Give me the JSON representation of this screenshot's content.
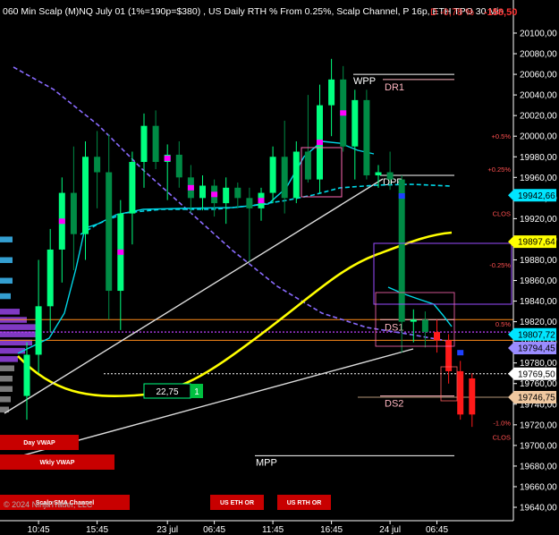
{
  "header": {
    "title": "060 Min Scalp (M)NQ July 01 (1%=190p=$380) , US Daily RTH % From 0.25%, Scalp Channel, P 16p, ETH TPO 30 Min",
    "overlay_text": "D -0,78 %",
    "overlay_value": "-158,50"
  },
  "footer": {
    "copyright": "© 2024 NinjaTrader, LLC"
  },
  "chart_data": {
    "type": "candlestick",
    "instrument": "(M)NQ July 01",
    "y_axis": {
      "ticks": [
        20100,
        20080,
        20060,
        20040,
        20020,
        20000,
        19980,
        19960,
        19940,
        19920,
        19900,
        19880,
        19860,
        19840,
        19820,
        19800,
        19780,
        19760,
        19740,
        19720,
        19700,
        19680,
        19660,
        19640
      ],
      "tick_labels": [
        "20100,00",
        "20080,00",
        "20060,00",
        "20040,00",
        "20020,00",
        "20000,00",
        "19980,00",
        "19960,00",
        "19940,00",
        "19920,00",
        "19900,00",
        "19880,00",
        "19860,00",
        "19840,00",
        "19820,00",
        "19800,00",
        "19780,00",
        "19760,00",
        "19740,00",
        "19720,00",
        "19700,00",
        "19680,00",
        "19660,00",
        "19640,00"
      ],
      "ylim": [
        19627,
        20113
      ]
    },
    "x_axis": {
      "tick_labels": [
        "10:45",
        "15:45",
        "23 jul",
        "06:45",
        "11:45",
        "16:45",
        "24 jul",
        "06:45"
      ],
      "tick_index": [
        1,
        6,
        12,
        16,
        21,
        26,
        31,
        35
      ]
    },
    "candles": [
      {
        "o": 19748,
        "h": 19800,
        "l": 19725,
        "c": 19788,
        "up": true
      },
      {
        "o": 19788,
        "h": 19880,
        "l": 19770,
        "c": 19835,
        "up": true
      },
      {
        "o": 19835,
        "h": 19910,
        "l": 19810,
        "c": 19890,
        "up": true
      },
      {
        "o": 19890,
        "h": 19960,
        "l": 19858,
        "c": 19945,
        "up": true
      },
      {
        "o": 19945,
        "h": 19990,
        "l": 19870,
        "c": 19905,
        "up": false
      },
      {
        "o": 19905,
        "h": 19995,
        "l": 19880,
        "c": 19980,
        "up": true
      },
      {
        "o": 19980,
        "h": 20005,
        "l": 19930,
        "c": 19965,
        "up": false
      },
      {
        "o": 19965,
        "h": 20002,
        "l": 19822,
        "c": 19850,
        "up": false
      },
      {
        "o": 19850,
        "h": 19938,
        "l": 19812,
        "c": 19925,
        "up": true
      },
      {
        "o": 19925,
        "h": 19985,
        "l": 19895,
        "c": 19975,
        "up": true
      },
      {
        "o": 19975,
        "h": 20022,
        "l": 19950,
        "c": 20010,
        "up": true
      },
      {
        "o": 20010,
        "h": 20025,
        "l": 19968,
        "c": 19975,
        "up": false
      },
      {
        "o": 19975,
        "h": 19992,
        "l": 19938,
        "c": 19982,
        "up": true
      },
      {
        "o": 19982,
        "h": 19995,
        "l": 19950,
        "c": 19960,
        "up": false
      },
      {
        "o": 19960,
        "h": 19972,
        "l": 19925,
        "c": 19940,
        "up": false
      },
      {
        "o": 19940,
        "h": 19962,
        "l": 19928,
        "c": 19952,
        "up": true
      },
      {
        "o": 19952,
        "h": 19958,
        "l": 19922,
        "c": 19935,
        "up": false
      },
      {
        "o": 19935,
        "h": 19960,
        "l": 19915,
        "c": 19950,
        "up": true
      },
      {
        "o": 19950,
        "h": 19955,
        "l": 19930,
        "c": 19940,
        "up": false
      },
      {
        "o": 19940,
        "h": 19950,
        "l": 19878,
        "c": 19930,
        "up": false
      },
      {
        "o": 19930,
        "h": 19950,
        "l": 19918,
        "c": 19945,
        "up": true
      },
      {
        "o": 19945,
        "h": 19990,
        "l": 19935,
        "c": 19980,
        "up": true
      },
      {
        "o": 19980,
        "h": 20015,
        "l": 19925,
        "c": 19940,
        "up": false
      },
      {
        "o": 19940,
        "h": 19995,
        "l": 19935,
        "c": 19985,
        "up": true
      },
      {
        "o": 19985,
        "h": 20040,
        "l": 19955,
        "c": 19958,
        "up": false
      },
      {
        "o": 19958,
        "h": 20050,
        "l": 19945,
        "c": 20030,
        "up": true
      },
      {
        "o": 20030,
        "h": 20075,
        "l": 20000,
        "c": 20055,
        "up": true
      },
      {
        "o": 20055,
        "h": 20068,
        "l": 19985,
        "c": 19990,
        "up": false
      },
      {
        "o": 19990,
        "h": 20045,
        "l": 19958,
        "c": 20035,
        "up": true
      },
      {
        "o": 20035,
        "h": 20045,
        "l": 19958,
        "c": 19962,
        "up": false
      },
      {
        "o": 19962,
        "h": 19972,
        "l": 19950,
        "c": 19965,
        "up": true
      },
      {
        "o": 19965,
        "h": 19985,
        "l": 19948,
        "c": 19958,
        "up": false
      },
      {
        "o": 19958,
        "h": 19962,
        "l": 19790,
        "c": 19820,
        "up": false
      },
      {
        "o": 19820,
        "h": 19832,
        "l": 19800,
        "c": 19822,
        "up": true
      },
      {
        "o": 19822,
        "h": 19830,
        "l": 19795,
        "c": 19810,
        "up": false
      },
      {
        "o": 19810,
        "h": 19822,
        "l": 19790,
        "c": 19802,
        "up": false
      },
      {
        "o": 19802,
        "h": 19808,
        "l": 19760,
        "c": 19772,
        "up": false
      },
      {
        "o": 19772,
        "h": 19782,
        "l": 19725,
        "c": 19730,
        "up": false
      },
      {
        "o": 19730,
        "h": 19770,
        "l": 19718,
        "c": 19765,
        "up": true
      }
    ],
    "level_lines": [
      {
        "name": "WPP",
        "price": 20060,
        "color": "#ffffff",
        "label": "WPP"
      },
      {
        "name": "DR1",
        "price": 20055,
        "color": "#ffb6c1",
        "label": "DR1"
      },
      {
        "name": "DPP",
        "price": 19962,
        "color": "#ffffff",
        "label": "DPP"
      },
      {
        "name": "DS1",
        "price": 19822,
        "color": "#ffb6c1",
        "label": "DS1"
      },
      {
        "name": "DS2",
        "price": 19748,
        "color": "#ffb6c1",
        "label": "DS2"
      },
      {
        "name": "MPP",
        "price": 19690,
        "color": "#ffffff",
        "label": "MPP"
      }
    ],
    "percent_labels": [
      {
        "text": "+0.5%",
        "price": 20000
      },
      {
        "text": "+0.25%",
        "price": 19968
      },
      {
        "text": "CLOS",
        "price": 19925
      },
      {
        "text": "-0.25%",
        "price": 19875
      },
      {
        "text": "0.5%",
        "price": 19818
      },
      {
        "text": "-1.0%",
        "price": 19722
      },
      {
        "text": "CLOS",
        "price": 19708
      }
    ],
    "price_tags": [
      {
        "text": "19942,66",
        "price": 19942.66,
        "bg": "#00e5ff",
        "fg": "#000000"
      },
      {
        "text": "19897,64",
        "price": 19897.64,
        "bg": "#ffff00",
        "fg": "#000000"
      },
      {
        "text": "19807,72",
        "price": 19807.72,
        "bg": "#00e5ff",
        "fg": "#000000"
      },
      {
        "text": "19794,45",
        "price": 19794.45,
        "bg": "#9a8cff",
        "fg": "#ffffff"
      },
      {
        "text": "19769,50",
        "price": 19769.5,
        "bg": "#ffffff",
        "fg": "#000000"
      },
      {
        "text": "19746,75",
        "price": 19746.75,
        "bg": "#f0c8a0",
        "fg": "#000000"
      }
    ],
    "position_box": {
      "value": "22,75",
      "qty": "1"
    },
    "buttons": [
      "Day VWAP",
      "Wkly VWAP",
      "Scalp SMA Channel",
      "US ETH OR",
      "US RTH OR"
    ],
    "colors": {
      "up": "#00ff7f",
      "down": "#008b45",
      "down_late": "#ff1a1a",
      "vwap": "#00d8e8",
      "yellow_ma": "#ffff00",
      "purple_ma": "#8a6bff",
      "trend": "#dddddd"
    }
  }
}
